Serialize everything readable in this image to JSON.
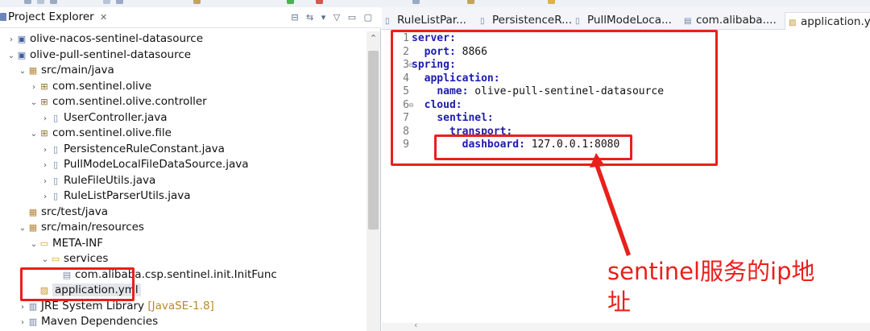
{
  "explorer": {
    "title": "Project Explorer",
    "close_glyph": "✕",
    "toolbar_glyphs": "⊟ ⇆ ▾ ▽ ▭ ▢"
  },
  "tree": [
    {
      "label": "olive-nacos-sentinel-datasource",
      "icon": "project-icon",
      "glyph": "▣",
      "twisty": "›",
      "indent": 0
    },
    {
      "label": "olive-pull-sentinel-datasource",
      "icon": "project-icon",
      "glyph": "▣",
      "twisty": "⌄",
      "indent": 0
    },
    {
      "label": "src/main/java",
      "icon": "source-folder-icon",
      "glyph": "▦",
      "twisty": "⌄",
      "indent": 1
    },
    {
      "label": "com.sentinel.olive",
      "icon": "package-icon",
      "glyph": "⊞",
      "twisty": "›",
      "indent": 2
    },
    {
      "label": "com.sentinel.olive.controller",
      "icon": "package-icon",
      "glyph": "⊞",
      "twisty": "⌄",
      "indent": 2
    },
    {
      "label": "UserController.java",
      "icon": "java-file-icon",
      "glyph": "▯",
      "twisty": "›",
      "indent": 3
    },
    {
      "label": "com.sentinel.olive.file",
      "icon": "package-icon",
      "glyph": "⊞",
      "twisty": "⌄",
      "indent": 2
    },
    {
      "label": "PersistenceRuleConstant.java",
      "icon": "java-file-icon",
      "glyph": "▯",
      "twisty": "›",
      "indent": 3
    },
    {
      "label": "PullModeLocalFileDataSource.java",
      "icon": "java-file-icon",
      "glyph": "▯",
      "twisty": "›",
      "indent": 3
    },
    {
      "label": "RuleFileUtils.java",
      "icon": "java-file-icon",
      "glyph": "▯",
      "twisty": "›",
      "indent": 3
    },
    {
      "label": "RuleListParserUtils.java",
      "icon": "java-file-icon",
      "glyph": "▯",
      "twisty": "›",
      "indent": 3
    },
    {
      "label": "src/test/java",
      "icon": "source-folder-icon",
      "glyph": "▦",
      "twisty": "",
      "indent": 1
    },
    {
      "label": "src/main/resources",
      "icon": "source-folder-icon",
      "glyph": "▦",
      "twisty": "⌄",
      "indent": 1
    },
    {
      "label": "META-INF",
      "icon": "folder-icon",
      "glyph": "▭",
      "twisty": "⌄",
      "indent": 2
    },
    {
      "label": "services",
      "icon": "folder-icon",
      "glyph": "▭",
      "twisty": "⌄",
      "indent": 3
    },
    {
      "label": "com.alibaba.csp.sentinel.init.InitFunc",
      "icon": "file-icon",
      "glyph": "▤",
      "twisty": "",
      "indent": 4
    },
    {
      "label": "application.yml",
      "icon": "yml-file-icon",
      "glyph": "▨",
      "twisty": "",
      "indent": 2,
      "selected": true
    },
    {
      "label": "JRE System Library",
      "extra": " [JavaSE-1.8]",
      "icon": "library-icon",
      "glyph": "▥",
      "twisty": "›",
      "indent": 1
    },
    {
      "label": "Maven Dependencies",
      "icon": "library-icon",
      "glyph": "▥",
      "twisty": "›",
      "indent": 1
    }
  ],
  "tabs": [
    {
      "label": "RuleListPar...",
      "icon": "java-file-icon",
      "glyph": "▯"
    },
    {
      "label": "PersistenceR...",
      "icon": "java-file-icon",
      "glyph": "▯"
    },
    {
      "label": "PullModeLoca...",
      "icon": "java-file-icon",
      "glyph": "▯"
    },
    {
      "label": "com.alibaba....",
      "icon": "file-icon",
      "glyph": "▤"
    },
    {
      "label": "application.ym",
      "icon": "yml-file-icon",
      "glyph": "▨",
      "active": true
    }
  ],
  "editor": {
    "lines": [
      {
        "n": "1",
        "indent": "",
        "key": "server:",
        "value": "",
        "fold": false
      },
      {
        "n": "2",
        "indent": "  ",
        "key": "port:",
        "value": " 8866",
        "fold": false
      },
      {
        "n": "3",
        "indent": "",
        "key": "spring:",
        "value": "",
        "fold": true
      },
      {
        "n": "4",
        "indent": "  ",
        "key": "application:",
        "value": "",
        "fold": false
      },
      {
        "n": "5",
        "indent": "    ",
        "key": "name:",
        "value": " olive-pull-sentinel-datasource",
        "fold": false
      },
      {
        "n": "6",
        "indent": "  ",
        "key": "cloud:",
        "value": "",
        "fold": true
      },
      {
        "n": "7",
        "indent": "    ",
        "key": "sentinel:",
        "value": "",
        "fold": false
      },
      {
        "n": "8",
        "indent": "      ",
        "key": "transport:",
        "value": "",
        "fold": false
      },
      {
        "n": "9",
        "indent": "        ",
        "key": "dashboard:",
        "value": " 127.0.0.1:8080",
        "fold": false
      }
    ]
  },
  "annotation": {
    "line1": "sentinel服务的ip地",
    "line2": "址",
    "color": "#e8201c"
  }
}
